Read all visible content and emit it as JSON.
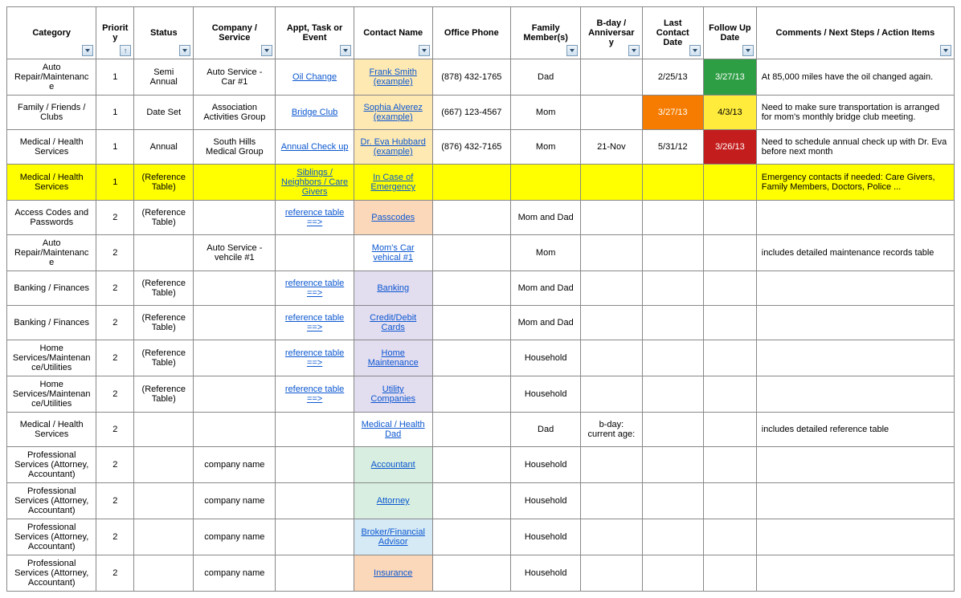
{
  "headers": {
    "category": "Category",
    "priority": "Priority",
    "status": "Status",
    "company": "Company / Service",
    "appt": "Appt, Task or Event",
    "contact": "Contact Name",
    "phone": "Office Phone",
    "family": "Family Member(s)",
    "bday": "B-day / Anniversary",
    "last": "Last Contact Date",
    "follow": "Follow Up Date",
    "comments": "Comments / Next Steps / Action Items"
  },
  "rows": [
    {
      "category": "Auto Repair/Maintenance",
      "priority": "1",
      "status": "Semi Annual",
      "company": "Auto Service - Car #1",
      "appt": "Oil Change",
      "apptLink": true,
      "contact": "Frank Smith (example)",
      "contactLink": true,
      "contactBg": "bg-orange-soft",
      "phone": "(878) 432-1765",
      "family": "Dad",
      "bday": "",
      "last": "2/25/13",
      "lastBg": "",
      "follow": "3/27/13",
      "followBg": "bg-green-hot",
      "comments": "At 85,000 miles have the oil changed again."
    },
    {
      "category": "Family / Friends / Clubs",
      "priority": "1",
      "status": "Date Set",
      "company": "Association Activities Group",
      "appt": "Bridge Club",
      "apptLink": true,
      "contact": "Sophia Alverez (example)",
      "contactLink": true,
      "contactBg": "bg-orange-soft",
      "phone": "(667) 123-4567",
      "family": "Mom",
      "bday": "",
      "last": "3/27/13",
      "lastBg": "bg-orange-hot",
      "follow": "4/3/13",
      "followBg": "bg-yellow-hot",
      "comments": "Need to make sure transportation is arranged for mom's monthly bridge club meeting."
    },
    {
      "category": "Medical / Health Services",
      "priority": "1",
      "status": "Annual",
      "company": "South Hills Medical Group",
      "appt": "Annual Check up",
      "apptLink": true,
      "contact": "Dr. Eva Hubbard (example)",
      "contactLink": true,
      "contactBg": "bg-orange-soft",
      "phone": "(876) 432-7165",
      "family": "Mom",
      "bday": "21-Nov",
      "last": "5/31/12",
      "lastBg": "",
      "follow": "3/26/13",
      "followBg": "bg-red-hot",
      "comments": "Need to schedule annual check up with Dr. Eva before next month"
    },
    {
      "rowClass": "row-yellow",
      "category": "Medical / Health Services",
      "priority": "1",
      "status": "(Reference Table)",
      "company": "",
      "appt": "Siblings / Neighbors / Care Givers",
      "apptLink": true,
      "contact": "In Case of Emergency ",
      "contactLink": true,
      "contactBg": "",
      "phone": "",
      "family": "",
      "bday": "",
      "last": "",
      "lastBg": "",
      "follow": "",
      "followBg": "",
      "comments": "Emergency contacts if needed: Care Givers, Family Members, Doctors, Police ..."
    },
    {
      "category": "Access Codes and Passwords",
      "priority": "2",
      "status": "(Reference Table)",
      "company": "",
      "appt": "reference table ==>",
      "apptLink": true,
      "contact": "Passcodes ",
      "contactLink": true,
      "contactBg": "bg-peach",
      "phone": "",
      "family": "Mom and Dad",
      "bday": "",
      "last": "",
      "lastBg": "",
      "follow": "",
      "followBg": "",
      "comments": ""
    },
    {
      "category": "Auto Repair/Maintenance",
      "priority": "2",
      "status": "",
      "company": "Auto Service - vehcile #1",
      "appt": "",
      "apptLink": false,
      "contact": "Mom's Car vehical #1",
      "contactLink": true,
      "contactBg": "",
      "phone": "",
      "family": "Mom",
      "bday": "",
      "last": "",
      "lastBg": "",
      "follow": "",
      "followBg": "",
      "comments": "includes detailed maintenance records table"
    },
    {
      "category": "Banking / Finances",
      "priority": "2",
      "status": "(Reference Table)",
      "company": "",
      "appt": "reference table ==>",
      "apptLink": true,
      "contact": "Banking ",
      "contactLink": true,
      "contactBg": "bg-lavender",
      "phone": "",
      "family": "Mom and Dad",
      "bday": "",
      "last": "",
      "lastBg": "",
      "follow": "",
      "followBg": "",
      "comments": ""
    },
    {
      "category": "Banking / Finances",
      "priority": "2",
      "status": "(Reference Table)",
      "company": "",
      "appt": "reference table ==>",
      "apptLink": true,
      "contact": "Credit/Debit Cards ",
      "contactLink": true,
      "contactBg": "bg-lavender",
      "phone": "",
      "family": "Mom and Dad",
      "bday": "",
      "last": "",
      "lastBg": "",
      "follow": "",
      "followBg": "",
      "comments": ""
    },
    {
      "category": "Home Services/Maintenance/Utilities",
      "priority": "2",
      "status": "(Reference Table)",
      "company": "",
      "appt": "reference table ==>",
      "apptLink": true,
      "contact": "Home Maintenance ",
      "contactLink": true,
      "contactBg": "bg-lavender",
      "phone": "",
      "family": "Household",
      "bday": "",
      "last": "",
      "lastBg": "",
      "follow": "",
      "followBg": "",
      "comments": ""
    },
    {
      "category": "Home Services/Maintenance/Utilities",
      "priority": "2",
      "status": "(Reference Table)",
      "company": "",
      "appt": "reference table ==>",
      "apptLink": true,
      "contact": "Utility Companies ",
      "contactLink": true,
      "contactBg": "bg-lavender",
      "phone": "",
      "family": "Household",
      "bday": "",
      "last": "",
      "lastBg": "",
      "follow": "",
      "followBg": "",
      "comments": ""
    },
    {
      "category": "Medical / Health Services",
      "priority": "2",
      "status": "",
      "company": "",
      "appt": "",
      "apptLink": false,
      "contact": "Medical / Health Dad",
      "contactLink": true,
      "contactBg": "",
      "phone": "",
      "family": "Dad",
      "bday": "b-day:  current age:",
      "last": "",
      "lastBg": "",
      "follow": "",
      "followBg": "",
      "comments": "includes detailed reference table"
    },
    {
      "category": "Professional Services (Attorney, Accountant)",
      "priority": "2",
      "status": "",
      "company": "company name",
      "appt": "",
      "apptLink": false,
      "contact": "Accountant ",
      "contactLink": true,
      "contactBg": "bg-mint",
      "phone": "",
      "family": "Household",
      "bday": "",
      "last": "",
      "lastBg": "",
      "follow": "",
      "followBg": "",
      "comments": ""
    },
    {
      "category": "Professional Services (Attorney, Accountant)",
      "priority": "2",
      "status": "",
      "company": "company name",
      "appt": "",
      "apptLink": false,
      "contact": "Attorney ",
      "contactLink": true,
      "contactBg": "bg-mint",
      "phone": "",
      "family": "Household",
      "bday": "",
      "last": "",
      "lastBg": "",
      "follow": "",
      "followBg": "",
      "comments": ""
    },
    {
      "category": "Professional Services (Attorney, Accountant)",
      "priority": "2",
      "status": "",
      "company": "company name",
      "appt": "",
      "apptLink": false,
      "contact": "Broker/Financial Advisor ",
      "contactLink": true,
      "contactBg": "bg-sky",
      "phone": "",
      "family": "Household",
      "bday": "",
      "last": "",
      "lastBg": "",
      "follow": "",
      "followBg": "",
      "comments": ""
    },
    {
      "category": "Professional Services (Attorney, Accountant)",
      "priority": "2",
      "status": "",
      "company": "company name",
      "appt": "",
      "apptLink": false,
      "contact": "Insurance ",
      "contactLink": true,
      "contactBg": "bg-peach",
      "phone": "",
      "family": "Household",
      "bday": "",
      "last": "",
      "lastBg": "",
      "follow": "",
      "followBg": "",
      "comments": ""
    }
  ]
}
